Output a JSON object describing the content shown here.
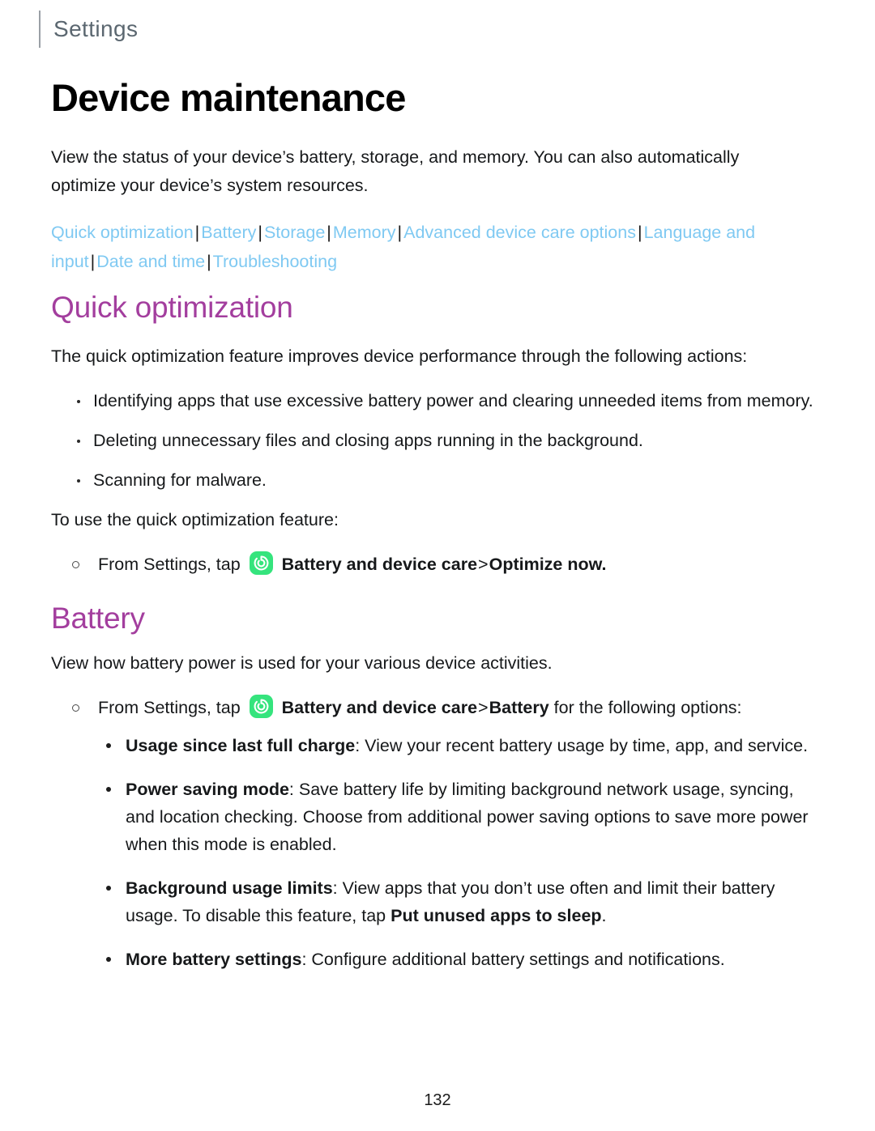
{
  "header": {
    "title": "Settings"
  },
  "doc": {
    "title": "Device maintenance",
    "intro": "View the status of your device’s battery, storage, and memory. You can also automatically optimize your device’s system resources."
  },
  "nav": {
    "links": [
      "Quick optimization",
      "Battery",
      "Storage",
      "Memory",
      "Advanced device care options",
      "Language and input",
      "Date and time",
      "Troubleshooting"
    ],
    "separator": "|"
  },
  "quick_optimization": {
    "heading": "Quick optimization",
    "intro": "The quick optimization feature improves device performance through the following actions:",
    "bullets": [
      "Identifying apps that use excessive battery power and clearing unneeded items from memory.",
      "Deleting unnecessary files and closing apps running in the background.",
      "Scanning for malware."
    ],
    "lead_in": "To use the quick optimization feature:",
    "step": {
      "prefix": "From Settings, tap",
      "bold_path": "Battery and device care",
      "chevron": ">",
      "bold_target": "Optimize now.",
      "icon": "battery-device-care-icon"
    }
  },
  "battery": {
    "heading": "Battery",
    "intro": "View how battery power is used for your various device activities.",
    "step": {
      "prefix": "From Settings, tap",
      "bold_path": "Battery and device care",
      "chevron": ">",
      "bold_target": "Battery",
      "suffix": "for the following options:",
      "icon": "battery-device-care-icon"
    },
    "options": [
      {
        "label": "Usage since last full charge",
        "text_before": ": View your recent battery usage by time, app, and service.",
        "bold_inline": "",
        "text_after": ""
      },
      {
        "label": "Power saving mode",
        "text_before": ": Save battery life by limiting background network usage, syncing, and location checking. Choose from additional power saving options to save more power when this mode is enabled.",
        "bold_inline": "",
        "text_after": ""
      },
      {
        "label": "Background usage limits",
        "text_before": ": View apps that you don’t use often and limit their battery usage. To disable this feature, tap ",
        "bold_inline": "Put unused apps to sleep",
        "text_after": "."
      },
      {
        "label": "More battery settings",
        "text_before": ": Configure additional battery settings and notifications.",
        "bold_inline": "",
        "text_after": ""
      }
    ]
  },
  "footer": {
    "page_number": "132"
  },
  "colors": {
    "section_heading": "#a33e9e",
    "link": "#7fc9f2",
    "icon_green": "#35e47d",
    "header_text": "#5b6770"
  }
}
